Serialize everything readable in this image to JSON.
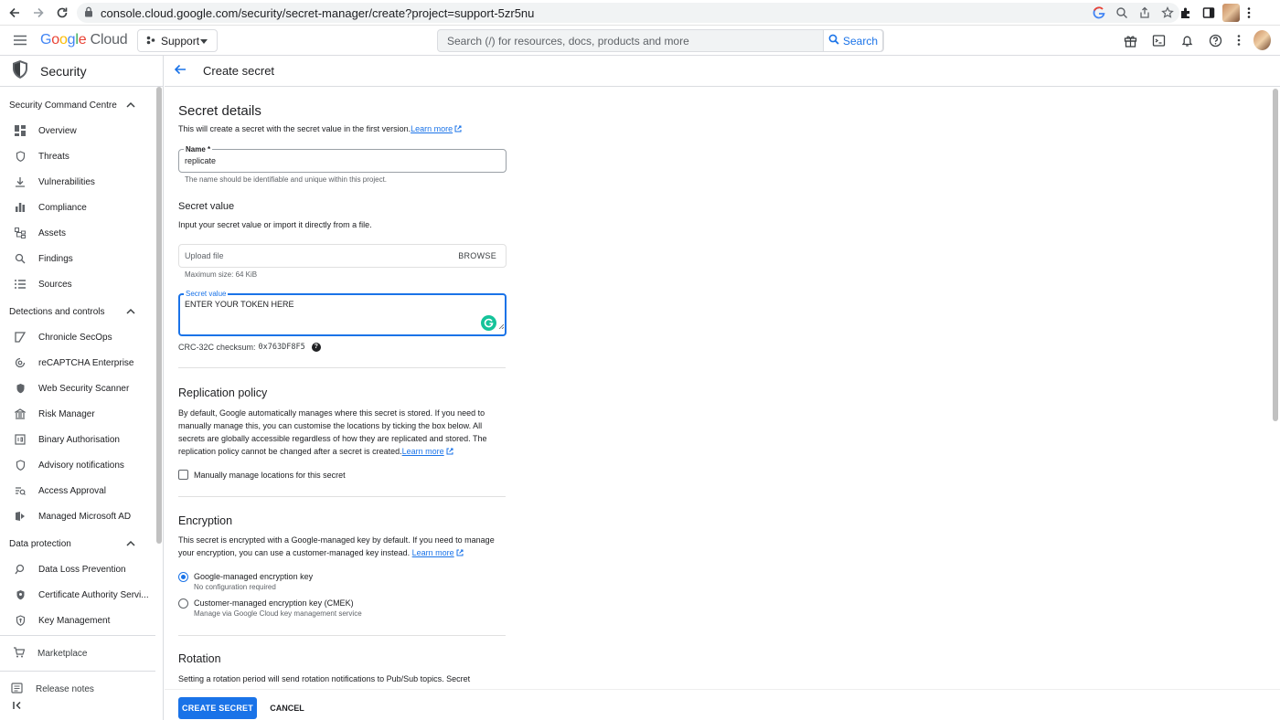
{
  "browser": {
    "url": "console.cloud.google.com/security/secret-manager/create?project=support-5zr5nu"
  },
  "header": {
    "logo_google": [
      "G",
      "o",
      "o",
      "g",
      "l",
      "e"
    ],
    "logo_cloud": "Cloud",
    "project": "Support",
    "search_placeholder": "Search (/) for resources, docs, products and more",
    "search_button": "Search"
  },
  "sidebar": {
    "product": "Security",
    "sections": [
      {
        "title": "Security Command Centre",
        "items": [
          {
            "label": "Overview",
            "icon": "dashboard-icon"
          },
          {
            "label": "Threats",
            "icon": "shield-icon"
          },
          {
            "label": "Vulnerabilities",
            "icon": "download-icon"
          },
          {
            "label": "Compliance",
            "icon": "bar-chart-icon"
          },
          {
            "label": "Assets",
            "icon": "hierarchy-icon"
          },
          {
            "label": "Findings",
            "icon": "search-doc-icon"
          },
          {
            "label": "Sources",
            "icon": "list-icon"
          }
        ]
      },
      {
        "title": "Detections and controls",
        "items": [
          {
            "label": "Chronicle SecOps",
            "icon": "chronicle-icon"
          },
          {
            "label": "reCAPTCHA Enterprise",
            "icon": "recaptcha-icon"
          },
          {
            "label": "Web Security Scanner",
            "icon": "shield-check-icon"
          },
          {
            "label": "Risk Manager",
            "icon": "bank-icon"
          },
          {
            "label": "Binary Authorisation",
            "icon": "binary-icon"
          },
          {
            "label": "Advisory notifications",
            "icon": "shield-icon"
          },
          {
            "label": "Access Approval",
            "icon": "approval-icon"
          },
          {
            "label": "Managed Microsoft AD",
            "icon": "ad-icon"
          }
        ]
      },
      {
        "title": "Data protection",
        "items": [
          {
            "label": "Data Loss Prevention",
            "icon": "dlp-icon"
          },
          {
            "label": "Certificate Authority Servi...",
            "icon": "certificate-icon"
          },
          {
            "label": "Key Management",
            "icon": "key-shield-icon"
          }
        ]
      }
    ],
    "footer": [
      {
        "label": "Marketplace",
        "icon": "cart-icon"
      },
      {
        "label": "Release notes",
        "icon": "notes-icon"
      }
    ]
  },
  "page": {
    "title": "Create secret",
    "details": {
      "heading": "Secret details",
      "description": "This will create a secret with the secret value in the first version.",
      "learn_more": "Learn more",
      "name_label": "Name *",
      "name_value": "replicate",
      "name_hint": "The name should be identifiable and unique within this project."
    },
    "secret_value": {
      "heading": "Secret value",
      "description": "Input your secret value or import it directly from a file.",
      "upload_placeholder": "Upload file",
      "browse": "BROWSE",
      "max_size": "Maximum size: 64 KiB",
      "value_label": "Secret value",
      "value": "ENTER YOUR TOKEN HERE",
      "checksum_label": "CRC-32C checksum:",
      "checksum_value": "0x763DF8F5"
    },
    "replication": {
      "heading": "Replication policy",
      "description": "By default, Google automatically manages where this secret is stored. If you need to manually manage this, you can customise the locations by ticking the box below. All secrets are globally accessible regardless of how they are replicated and stored. The replication policy cannot be changed after a secret is created.",
      "learn_more": "Learn more",
      "checkbox_label": "Manually manage locations for this secret"
    },
    "encryption": {
      "heading": "Encryption",
      "description": "This secret is encrypted with a Google-managed key by default. If you need to manage your encryption, you can use a customer-managed key instead.",
      "learn_more": "Learn more",
      "options": [
        {
          "label": "Google-managed encryption key",
          "sub": "No configuration required",
          "selected": true
        },
        {
          "label": "Customer-managed encryption key (CMEK)",
          "sub": "Manage via Google Cloud key management service",
          "selected": false
        }
      ]
    },
    "rotation": {
      "heading": "Rotation",
      "description": "Setting a rotation period will send rotation notifications to Pub/Sub topics. Secret"
    },
    "actions": {
      "create": "CREATE SECRET",
      "cancel": "CANCEL"
    }
  }
}
